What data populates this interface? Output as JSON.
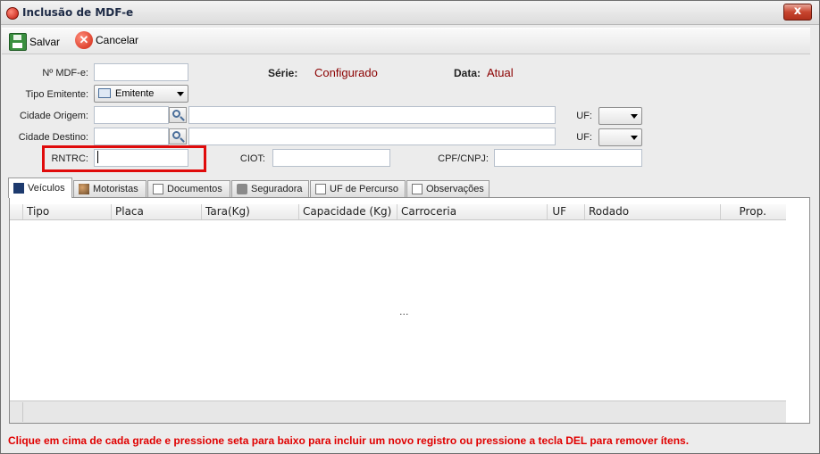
{
  "window": {
    "title": "Inclusão de MDF-e",
    "close_symbol": "x"
  },
  "toolbar": {
    "save_label": "Salvar",
    "cancel_label": "Cancelar"
  },
  "form": {
    "mdfe_label": "Nº MDF-e:",
    "mdfe_value": "",
    "serie_label": "Série:",
    "serie_value": "Configurado",
    "data_label": "Data:",
    "data_value": "Atual",
    "tipo_emitente_label": "Tipo Emitente:",
    "tipo_emitente_value": "Emitente",
    "cidade_origem_label": "Cidade Origem:",
    "cidade_origem_value": "",
    "cidade_destino_label": "Cidade Destino:",
    "cidade_destino_value": "",
    "uf_label": "UF:",
    "uf_origem_value": "",
    "uf_destino_value": "",
    "rntrc_label": "RNTRC:",
    "rntrc_value": "",
    "ciot_label": "CIOT:",
    "ciot_value": "",
    "cpf_cnpj_label": "CPF/CNPJ:",
    "cpf_cnpj_value": ""
  },
  "tabs": [
    {
      "label": "Veículos",
      "icon": "vehicle-icon",
      "active": true
    },
    {
      "label": "Motoristas",
      "icon": "people-icon"
    },
    {
      "label": "Documentos",
      "icon": "document-icon"
    },
    {
      "label": "Seguradora",
      "icon": "lock-icon"
    },
    {
      "label": "UF de Percurso",
      "icon": "list-icon"
    },
    {
      "label": "Observações",
      "icon": "notes-icon"
    }
  ],
  "grid": {
    "columns": [
      "Tipo",
      "Placa",
      "Tara(Kg)",
      "Capacidade (Kg)",
      "Carroceria",
      "UF",
      "Rodado",
      "Prop."
    ],
    "empty_marker": "..."
  },
  "status_message": "Clique em cima de cada grade e pressione seta para baixo para incluir um novo registro ou pressione a tecla DEL para remover ítens.",
  "colors": {
    "highlight": "#e00b0b",
    "status": "#e00000",
    "value": "#8b0000"
  }
}
